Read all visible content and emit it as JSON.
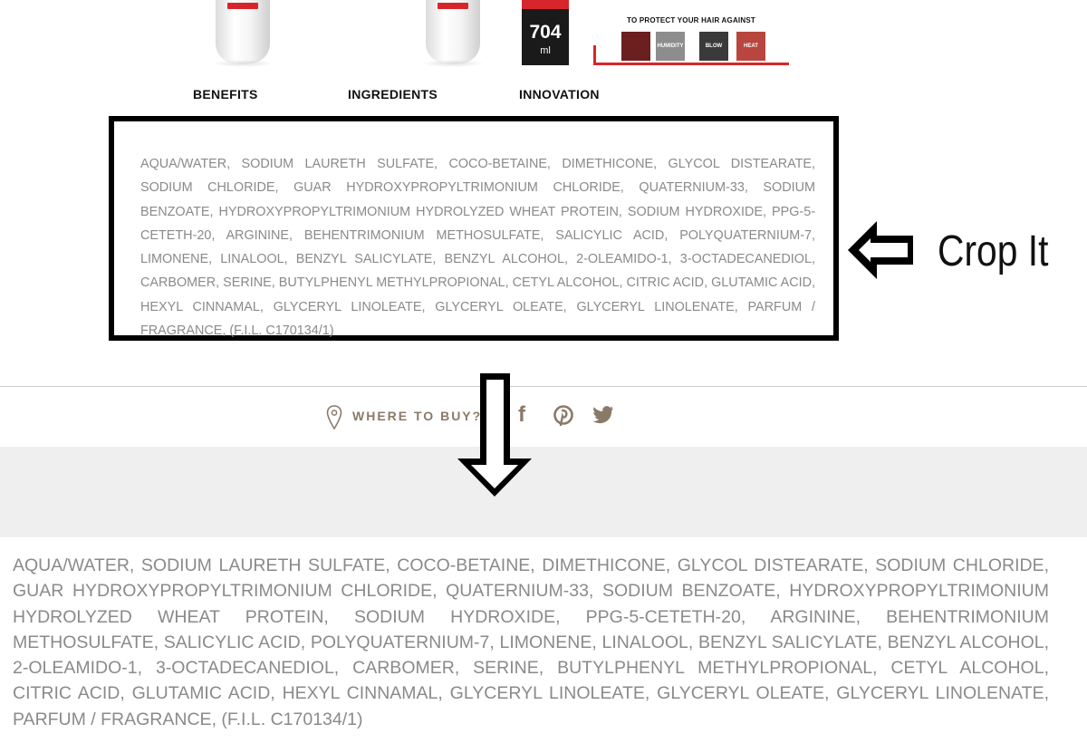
{
  "products": {
    "volume_number": "704",
    "volume_unit": "ml",
    "protect_headline": "TO PROTECT YOUR HAIR AGAINST",
    "protect_items": [
      "",
      "HUMIDITY",
      "BLOW DRYING",
      "HEAT"
    ]
  },
  "tabs": [
    "BENEFITS",
    "INGREDIENTS",
    "INNOVATION"
  ],
  "ingredients_text": "AQUA/WATER, SODIUM LAURETH SULFATE, COCO-BETAINE, DIMETHICONE, GLYCOL DISTEARATE, SODIUM CHLORIDE, GUAR HYDROXYPROPYLTRIMONIUM CHLORIDE, QUATERNIUM-33, SODIUM BENZOATE, HYDROXYPROPYLTRIMONIUM HYDROLYZED WHEAT PROTEIN, SODIUM HYDROXIDE, PPG-5-CETETH-20, ARGININE, BEHENTRIMONIUM METHOSULFATE, SALICYLIC ACID, POLYQUATERNIUM-7, LIMONENE, LINALOOL, BENZYL SALICYLATE, BENZYL ALCOHOL, 2-OLEAMIDO-1, 3-OCTADECANEDIOL, CARBOMER, SERINE, BUTYLPHENYL METHYLPROPIONAL, CETYL ALCOHOL, CITRIC ACID, GLUTAMIC ACID, HEXYL CINNAMAL, GLYCERYL LINOLEATE, GLYCERYL OLEATE, GLYCERYL LINOLENATE, PARFUM / FRAGRANCE, (F.I.L. C170134/1)",
  "annotation": {
    "crop_label": "Crop It"
  },
  "where_to_buy": "WHERE TO BUY?",
  "social": {
    "facebook_glyph": "f"
  },
  "icons": {
    "location": "location-pin-icon",
    "facebook": "facebook-icon",
    "pinterest": "pinterest-icon",
    "twitter": "twitter-icon"
  },
  "colors": {
    "brand_red": "#d7262b",
    "ingredient_gray": "#8a8a8a",
    "where_brown": "#8a7a68"
  }
}
